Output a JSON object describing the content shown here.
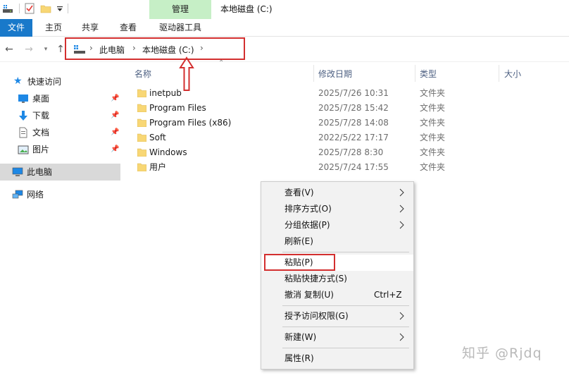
{
  "window": {
    "title": "本地磁盘 (C:)",
    "context_tab_group": "管理"
  },
  "ribbon": {
    "tabs": [
      "文件",
      "主页",
      "共享",
      "查看",
      "驱动器工具"
    ]
  },
  "address": {
    "crumbs": [
      "此电脑",
      "本地磁盘 (C:)"
    ]
  },
  "sidebar": {
    "items": [
      {
        "label": "快速访问",
        "icon": "star-icon",
        "pinned": false
      },
      {
        "label": "桌面",
        "icon": "desktop-icon",
        "pinned": true
      },
      {
        "label": "下载",
        "icon": "download-icon",
        "pinned": true
      },
      {
        "label": "文档",
        "icon": "document-icon",
        "pinned": true
      },
      {
        "label": "图片",
        "icon": "picture-icon",
        "pinned": true
      },
      {
        "label": "此电脑",
        "icon": "computer-icon",
        "pinned": false,
        "selected": true
      },
      {
        "label": "网络",
        "icon": "network-icon",
        "pinned": false
      }
    ]
  },
  "columns": {
    "name": "名称",
    "modified": "修改日期",
    "type": "类型",
    "size": "大小"
  },
  "files": [
    {
      "name": "inetpub",
      "modified": "2025/7/26 10:31",
      "type": "文件夹"
    },
    {
      "name": "Program Files",
      "modified": "2025/7/28 15:42",
      "type": "文件夹"
    },
    {
      "name": "Program Files (x86)",
      "modified": "2025/7/28 14:08",
      "type": "文件夹"
    },
    {
      "name": "Soft",
      "modified": "2022/5/22 17:17",
      "type": "文件夹"
    },
    {
      "name": "Windows",
      "modified": "2025/7/28 8:30",
      "type": "文件夹"
    },
    {
      "name": "用户",
      "modified": "2025/7/24 17:55",
      "type": "文件夹"
    }
  ],
  "context_menu": {
    "items": [
      {
        "label": "查看(V)",
        "submenu": true
      },
      {
        "label": "排序方式(O)",
        "submenu": true
      },
      {
        "label": "分组依据(P)",
        "submenu": true
      },
      {
        "label": "刷新(E)"
      },
      {
        "label": "粘贴(P)",
        "highlighted": true
      },
      {
        "label": "粘贴快捷方式(S)"
      },
      {
        "label": "撤消 复制(U)",
        "shortcut": "Ctrl+Z"
      },
      {
        "label": "授予访问权限(G)",
        "submenu": true
      },
      {
        "label": "新建(W)",
        "submenu": true
      },
      {
        "label": "属性(R)"
      }
    ]
  },
  "watermark": "知乎 @Rjdq",
  "colors": {
    "accent": "#1979ca",
    "annotation": "#d32f2f",
    "context_tab": "#c6efc6",
    "folder": "#f8d775"
  }
}
